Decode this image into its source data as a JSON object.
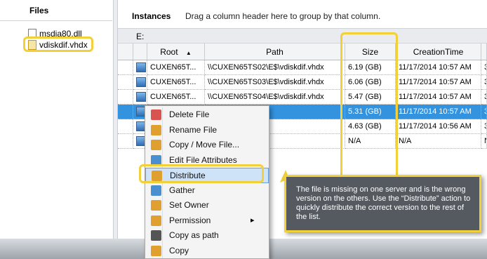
{
  "files_panel": {
    "title": "Files",
    "items": [
      {
        "name": "msdia80.dll"
      },
      {
        "name": "vdiskdif.vhdx"
      }
    ]
  },
  "instances": {
    "title": "Instances",
    "hint": "Drag a column header here to group by that column.",
    "group_label": "E:",
    "columns": [
      "Root",
      "Path",
      "Size",
      "CreationTime"
    ],
    "rows": [
      {
        "root": "CUXEN65T...",
        "path": "\\\\CUXEN65TS02\\E$\\vdiskdif.vhdx",
        "size": "6.19 (GB)",
        "created": "11/17/2014 10:57 AM",
        "extra": "3",
        "selected": false
      },
      {
        "root": "CUXEN65T...",
        "path": "\\\\CUXEN65TS03\\E$\\vdiskdif.vhdx",
        "size": "6.06 (GB)",
        "created": "11/17/2014 10:57 AM",
        "extra": "3",
        "selected": false
      },
      {
        "root": "CUXEN65T...",
        "path": "\\\\CUXEN65TS04\\E$\\vdiskdif.vhdx",
        "size": "5.47 (GB)",
        "created": "11/17/2014 10:57 AM",
        "extra": "3",
        "selected": false
      },
      {
        "root": "",
        "path": "\\E$\\vdiskdif.vhdx",
        "size": "5.31 (GB)",
        "created": "11/17/2014 10:57 AM",
        "extra": "3",
        "selected": true
      },
      {
        "root": "",
        "path": "\\E$\\vdiskdif.vhdx",
        "size": "4.63 (GB)",
        "created": "11/17/2014 10:56 AM",
        "extra": "3",
        "selected": false
      },
      {
        "root": "",
        "path": "",
        "size": "N/A",
        "created": "N/A",
        "extra": "N",
        "selected": false
      }
    ]
  },
  "context_menu": {
    "items": [
      {
        "label": "Delete File",
        "icon": "delete-file-icon",
        "color": "#d9534f"
      },
      {
        "label": "Rename File",
        "icon": "rename-file-icon",
        "color": "#e0a030"
      },
      {
        "label": "Copy / Move File...",
        "icon": "copy-move-icon",
        "color": "#e0a030"
      },
      {
        "label": "Edit File Attributes",
        "icon": "edit-attributes-icon",
        "color": "#4a90d0"
      },
      {
        "label": "Distribute",
        "icon": "distribute-icon",
        "color": "#e0a030",
        "highlighted": true
      },
      {
        "label": "Gather",
        "icon": "gather-icon",
        "color": "#4a90d0"
      },
      {
        "label": "Set Owner",
        "icon": "set-owner-icon",
        "color": "#e0a030"
      },
      {
        "label": "Permission",
        "icon": "permission-icon",
        "color": "#e0a030",
        "submenu": true
      },
      {
        "label": "Copy as path",
        "icon": "copy-path-icon",
        "color": "#555555"
      },
      {
        "label": "Copy",
        "icon": "copy-icon",
        "color": "#e0a030"
      }
    ]
  },
  "callout": {
    "text": "The file is missing on one server and is the wrong version on the others. Use the “Distribute” action to quickly distribute the correct version to the rest of the list."
  },
  "colors": {
    "selection": "#3393df",
    "highlight_border": "#f2d03a",
    "callout_bg": "#555a60"
  }
}
